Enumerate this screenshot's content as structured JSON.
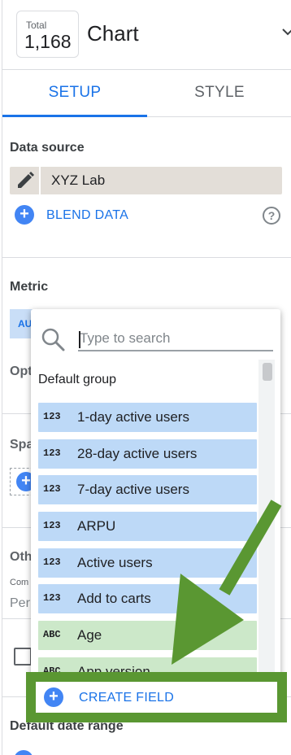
{
  "header": {
    "total_label": "Total",
    "total_value": "1,168",
    "title": "Chart"
  },
  "tabs": [
    {
      "label": "SETUP",
      "active": true
    },
    {
      "label": "STYLE",
      "active": false
    }
  ],
  "data_source": {
    "section_title": "Data source",
    "name": "XYZ Lab",
    "blend_label": "BLEND DATA",
    "help_symbol": "?"
  },
  "metric": {
    "section_title": "Metric",
    "chip_text": "AU"
  },
  "background_cut": {
    "optional_label": "Opt",
    "sparkline_label": "Spa",
    "other_label": "Oth",
    "comparison_small": "Com",
    "percent_text": "Per",
    "date_range_title": "Default date range"
  },
  "field_picker": {
    "search_placeholder": "Type to search",
    "search_value": "",
    "group_label": "Default group",
    "fields": [
      {
        "type": "123",
        "name": "1-day active users",
        "kind": "number"
      },
      {
        "type": "123",
        "name": "28-day active users",
        "kind": "number"
      },
      {
        "type": "123",
        "name": "7-day active users",
        "kind": "number"
      },
      {
        "type": "123",
        "name": "ARPU",
        "kind": "number"
      },
      {
        "type": "123",
        "name": "Active users",
        "kind": "number"
      },
      {
        "type": "123",
        "name": "Add to carts",
        "kind": "number"
      },
      {
        "type": "ABC",
        "name": "Age",
        "kind": "text"
      },
      {
        "type": "ABC",
        "name": "App version",
        "kind": "text"
      }
    ],
    "create_field_label": "CREATE FIELD",
    "plus_symbol": "+"
  },
  "colors": {
    "accent_blue": "#1a73e8",
    "plus_blue": "#4285f4",
    "number_field_bg": "#bdd9f7",
    "text_field_bg": "#cce8c9",
    "highlight_green": "#5a9732",
    "datasource_bg": "#e3ded8"
  },
  "icons": {
    "edit": "pencil-icon",
    "search": "search-icon",
    "help": "help-icon",
    "add": "plus-circle-icon",
    "chevron": "chevron-down-icon",
    "annotation": "green-arrow-icon"
  }
}
